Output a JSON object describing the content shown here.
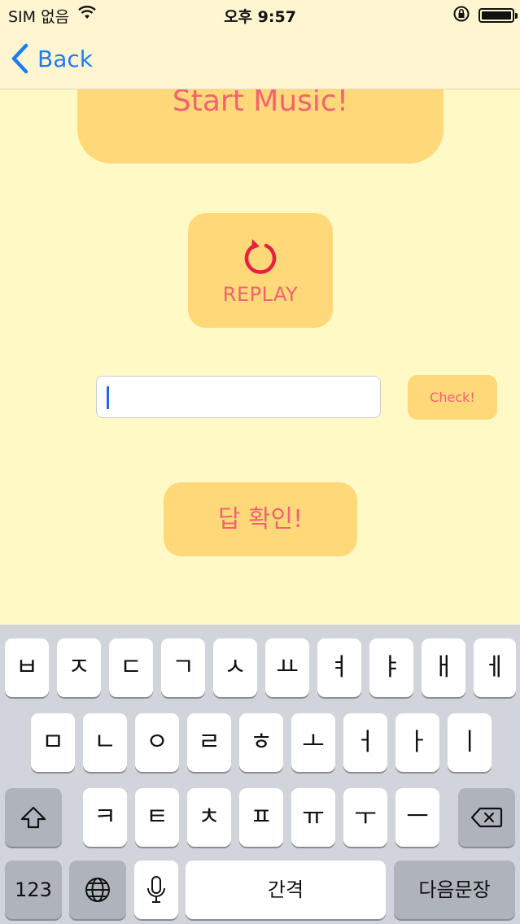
{
  "status_bar": {
    "carrier": "SIM 없음",
    "time": "오후 9:57"
  },
  "nav": {
    "back_label": "Back"
  },
  "title_card": {
    "text": "Start Music!"
  },
  "replay": {
    "label": "REPLAY"
  },
  "answer": {
    "value": "",
    "check_label": "Check!"
  },
  "reveal": {
    "label": "답 확인!"
  },
  "keyboard": {
    "row1": [
      "ㅂ",
      "ㅈ",
      "ㄷ",
      "ㄱ",
      "ㅅ",
      "ㅛ",
      "ㅕ",
      "ㅑ",
      "ㅐ",
      "ㅔ"
    ],
    "row2": [
      "ㅁ",
      "ㄴ",
      "ㅇ",
      "ㄹ",
      "ㅎ",
      "ㅗ",
      "ㅓ",
      "ㅏ",
      "ㅣ"
    ],
    "row3": [
      "ㅋ",
      "ㅌ",
      "ㅊ",
      "ㅍ",
      "ㅠ",
      "ㅜ",
      "ㅡ"
    ],
    "numbers_label": "123",
    "space_label": "간격",
    "return_label": "다음문장",
    "icons": {
      "shift": "shift-icon",
      "delete": "delete-icon",
      "globe": "globe-icon",
      "mic": "microphone-icon"
    }
  },
  "colors": {
    "background": "#FFF9C6",
    "button": "#FFD87A",
    "accent_text": "#F0636F",
    "link": "#1E7CF2"
  }
}
